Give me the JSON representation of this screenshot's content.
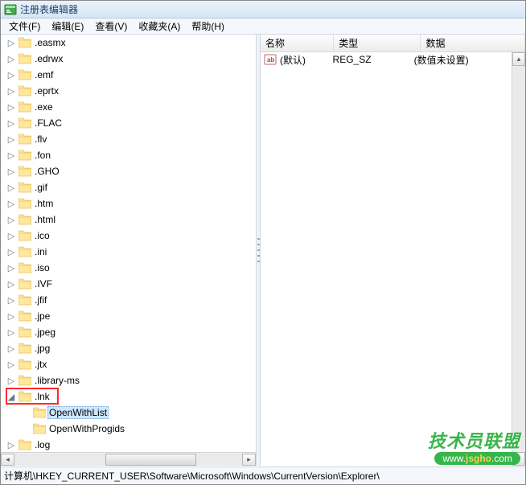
{
  "window": {
    "title": "注册表编辑器"
  },
  "menu": {
    "file": "文件(F)",
    "edit": "编辑(E)",
    "view": "查看(V)",
    "favorites": "收藏夹(A)",
    "help": "帮助(H)"
  },
  "tree": {
    "items": [
      {
        "label": ".easmx",
        "depth": 9,
        "expanded": false
      },
      {
        "label": ".edrwx",
        "depth": 9,
        "expanded": false
      },
      {
        "label": ".emf",
        "depth": 9,
        "expanded": false
      },
      {
        "label": ".eprtx",
        "depth": 9,
        "expanded": false
      },
      {
        "label": ".exe",
        "depth": 9,
        "expanded": false
      },
      {
        "label": ".FLAC",
        "depth": 9,
        "expanded": false
      },
      {
        "label": ".flv",
        "depth": 9,
        "expanded": false
      },
      {
        "label": ".fon",
        "depth": 9,
        "expanded": false
      },
      {
        "label": ".GHO",
        "depth": 9,
        "expanded": false
      },
      {
        "label": ".gif",
        "depth": 9,
        "expanded": false
      },
      {
        "label": ".htm",
        "depth": 9,
        "expanded": false
      },
      {
        "label": ".html",
        "depth": 9,
        "expanded": false
      },
      {
        "label": ".ico",
        "depth": 9,
        "expanded": false
      },
      {
        "label": ".ini",
        "depth": 9,
        "expanded": false
      },
      {
        "label": ".iso",
        "depth": 9,
        "expanded": false
      },
      {
        "label": ".IVF",
        "depth": 9,
        "expanded": false
      },
      {
        "label": ".jfif",
        "depth": 9,
        "expanded": false
      },
      {
        "label": ".jpe",
        "depth": 9,
        "expanded": false
      },
      {
        "label": ".jpeg",
        "depth": 9,
        "expanded": false
      },
      {
        "label": ".jpg",
        "depth": 9,
        "expanded": false
      },
      {
        "label": ".jtx",
        "depth": 9,
        "expanded": false
      },
      {
        "label": ".library-ms",
        "depth": 9,
        "expanded": false
      },
      {
        "label": ".lnk",
        "depth": 9,
        "expanded": true,
        "highlight": true
      },
      {
        "label": "OpenWithList",
        "depth": 10,
        "expanded": null,
        "selected": true
      },
      {
        "label": "OpenWithProgids",
        "depth": 10,
        "expanded": null
      },
      {
        "label": ".log",
        "depth": 9,
        "expanded": false
      }
    ]
  },
  "list": {
    "columns": {
      "name": "名称",
      "type": "类型",
      "data": "数据"
    },
    "col_widths": {
      "name": 105,
      "type": 125,
      "data": 150
    },
    "rows": [
      {
        "name": "(默认)",
        "type": "REG_SZ",
        "data": "(数值未设置)"
      }
    ]
  },
  "status": {
    "path": "计算机\\HKEY_CURRENT_USER\\Software\\Microsoft\\Windows\\CurrentVersion\\Explorer\\"
  },
  "watermark": {
    "line1": "技术员联盟",
    "line2_pre": "www.",
    "line2_mid": "jsgho",
    "line2_post": ".com"
  }
}
